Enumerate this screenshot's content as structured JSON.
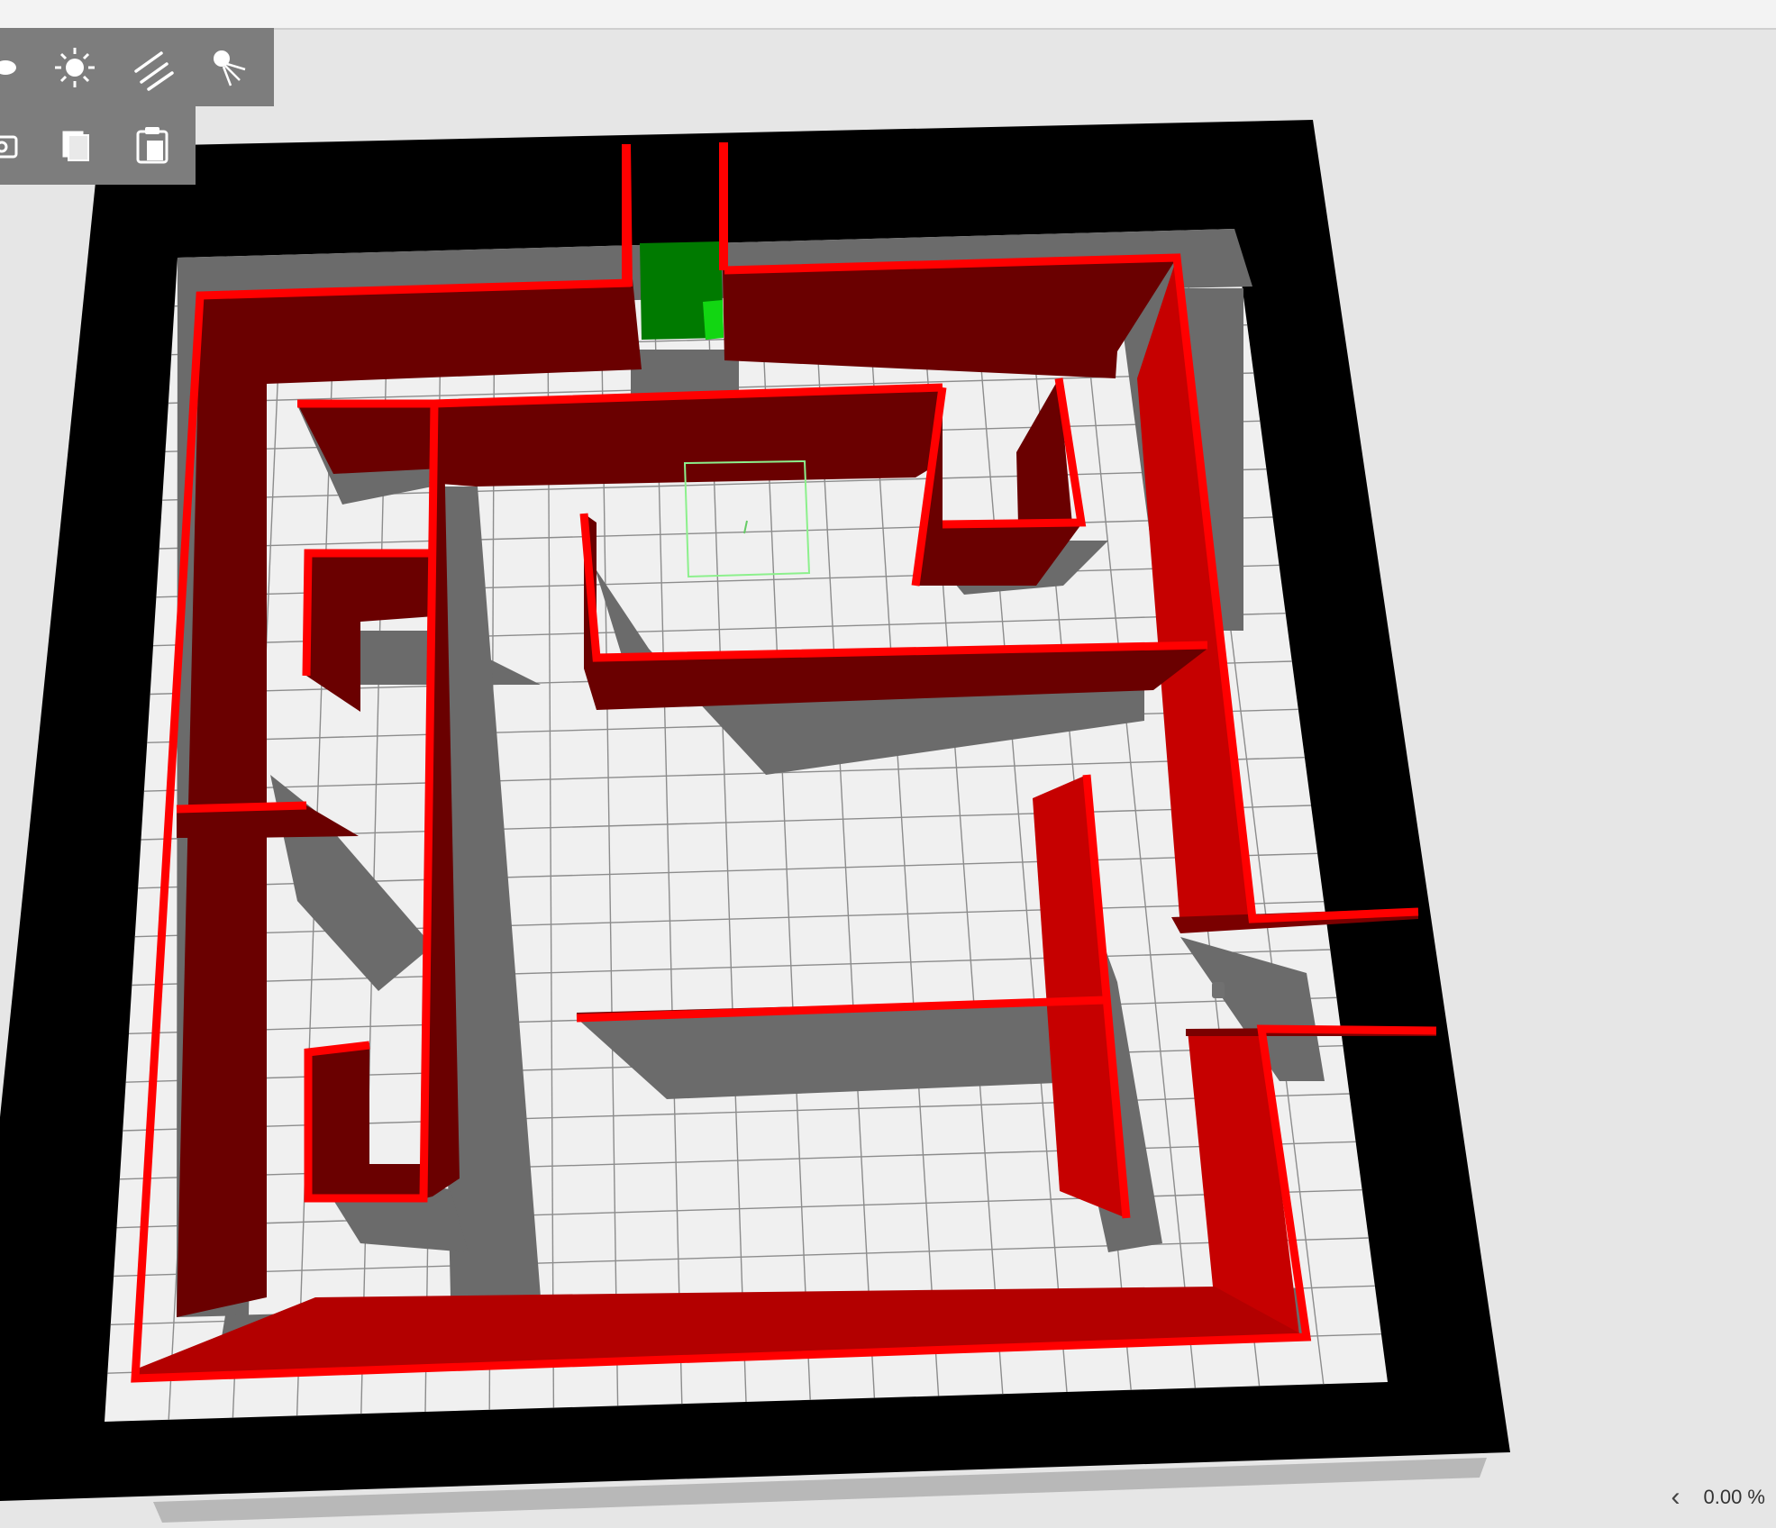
{
  "scene": {
    "floor_color": "#000000",
    "grid_color": "#f0f0f0",
    "wall_color": "#ff0000",
    "goal_color": "#007a00",
    "robot_outline_color": "#8cf08c"
  },
  "toolbar": {
    "row1": [
      {
        "icon": "ellipse-shape-icon"
      },
      {
        "icon": "light-icon"
      },
      {
        "icon": "directional-light-icon"
      },
      {
        "icon": "spot-light-icon"
      }
    ],
    "row2": [
      {
        "icon": "screenshot-icon"
      },
      {
        "icon": "copy-icon"
      },
      {
        "icon": "paste-icon"
      }
    ]
  },
  "status": {
    "progress": "0.00 %",
    "prev_symbol": "‹"
  }
}
